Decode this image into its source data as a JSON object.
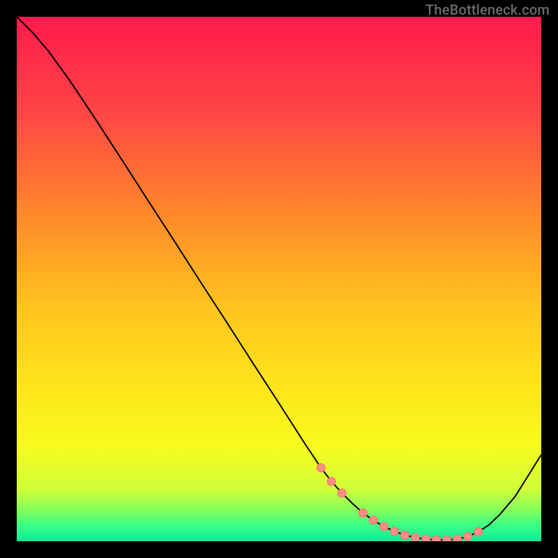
{
  "watermark": "TheBottleneck.com",
  "colors": {
    "gradient_stops": [
      {
        "offset": 0.0,
        "color": "#ff1a4c"
      },
      {
        "offset": 0.18,
        "color": "#ff4545"
      },
      {
        "offset": 0.38,
        "color": "#ff8a2a"
      },
      {
        "offset": 0.55,
        "color": "#ffc31f"
      },
      {
        "offset": 0.7,
        "color": "#ffe41a"
      },
      {
        "offset": 0.82,
        "color": "#f7fb1e"
      },
      {
        "offset": 0.9,
        "color": "#d0ff39"
      },
      {
        "offset": 0.94,
        "color": "#86ff5a"
      },
      {
        "offset": 0.97,
        "color": "#3aff85"
      },
      {
        "offset": 1.0,
        "color": "#12e89a"
      }
    ],
    "marker_fill": "#ff8d88",
    "marker_stroke": "#ff6b63",
    "curve": "#000000"
  },
  "chart_data": {
    "type": "line",
    "title": "",
    "xlabel": "",
    "ylabel": "",
    "xlim": [
      0,
      100
    ],
    "ylim": [
      0,
      100
    ],
    "x": [
      0,
      3,
      6,
      10,
      15,
      20,
      25,
      30,
      35,
      40,
      45,
      50,
      55,
      58,
      60,
      62,
      64,
      66,
      68,
      70,
      72,
      74,
      76,
      78,
      80,
      82,
      84,
      86,
      88,
      90,
      92,
      95,
      100
    ],
    "values": [
      100,
      97,
      93.5,
      88,
      80.5,
      72.8,
      65,
      57.3,
      49.5,
      41.8,
      34,
      26.3,
      18.5,
      14,
      11.4,
      9.2,
      7.2,
      5.4,
      4.0,
      2.8,
      1.9,
      1.2,
      0.7,
      0.4,
      0.25,
      0.25,
      0.4,
      0.9,
      1.8,
      3.1,
      5.0,
      8.5,
      16.5
    ],
    "markers": {
      "x": [
        58,
        60,
        62,
        66,
        68,
        70,
        72,
        74,
        76,
        78,
        80,
        82,
        84,
        86,
        88
      ],
      "y": [
        14.0,
        11.4,
        9.2,
        5.4,
        4.0,
        2.8,
        1.9,
        1.2,
        0.7,
        0.4,
        0.25,
        0.25,
        0.4,
        0.9,
        1.8
      ]
    }
  }
}
